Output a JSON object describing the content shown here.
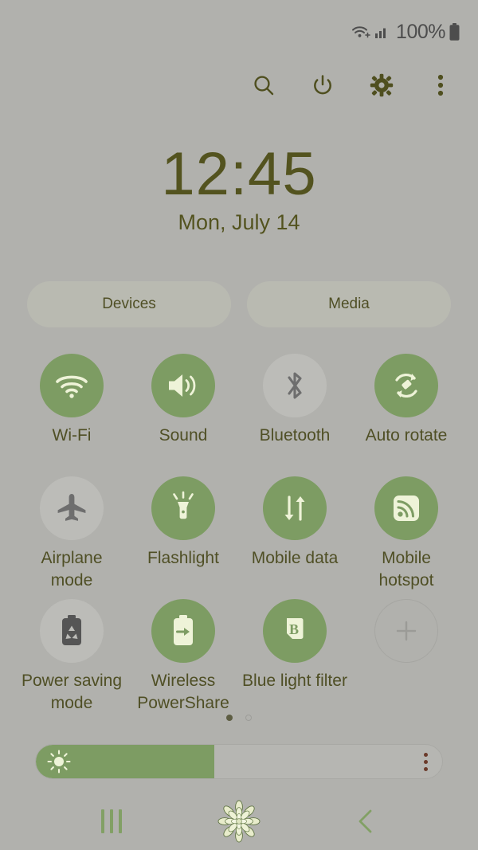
{
  "status_bar": {
    "wifi_icon": "wifi-signal-icon",
    "cellular_icon": "cellular-signal-icon",
    "battery_percent": "100%",
    "battery_icon": "battery-full-icon"
  },
  "toolbar": {
    "items": [
      {
        "name": "search-button",
        "icon": "search-icon"
      },
      {
        "name": "power-button",
        "icon": "power-icon"
      },
      {
        "name": "settings-button",
        "icon": "gear-icon"
      },
      {
        "name": "more-options-button",
        "icon": "three-dots-vertical-icon"
      }
    ]
  },
  "clock": {
    "time": "12:45",
    "date": "Mon, July 14"
  },
  "pills": {
    "devices_label": "Devices",
    "media_label": "Media"
  },
  "quick_settings": {
    "tiles": [
      {
        "label": "Wi-Fi",
        "icon": "wifi-icon",
        "state": "on"
      },
      {
        "label": "Sound",
        "icon": "speaker-icon",
        "state": "on"
      },
      {
        "label": "Bluetooth",
        "icon": "bluetooth-icon",
        "state": "off"
      },
      {
        "label": "Auto rotate",
        "icon": "auto-rotate-icon",
        "state": "on"
      },
      {
        "label": "Airplane mode",
        "icon": "airplane-icon",
        "state": "off"
      },
      {
        "label": "Flashlight",
        "icon": "flashlight-icon",
        "state": "on"
      },
      {
        "label": "Mobile data",
        "icon": "data-arrows-icon",
        "state": "on"
      },
      {
        "label": "Mobile hotspot",
        "icon": "hotspot-icon",
        "state": "on"
      },
      {
        "label": "Power saving mode",
        "icon": "battery-recycle-icon",
        "state": "off"
      },
      {
        "label": "Wireless PowerShare",
        "icon": "battery-share-icon",
        "state": "on"
      },
      {
        "label": "Blue light filter",
        "icon": "blue-light-b-icon",
        "state": "on"
      },
      {
        "label": "",
        "icon": "plus-icon",
        "state": "add"
      }
    ]
  },
  "page_indicator": {
    "total": 2,
    "active_index": 0
  },
  "brightness": {
    "icon": "sun-icon",
    "value_percent": 44,
    "menu_icon": "three-dots-vertical-icon"
  },
  "nav_bar": {
    "recents_label": "recents-icon",
    "home_label": "home-succulent-icon",
    "back_label": "back-chevron-icon"
  },
  "colors": {
    "background": "#b1b1ad",
    "accent_green": "#7d9c63",
    "icon_cream": "#eef3d8",
    "text_olive": "#4f4f25",
    "inactive_circle": "#bcbcb8",
    "inactive_icon": "#6e6e6e"
  }
}
